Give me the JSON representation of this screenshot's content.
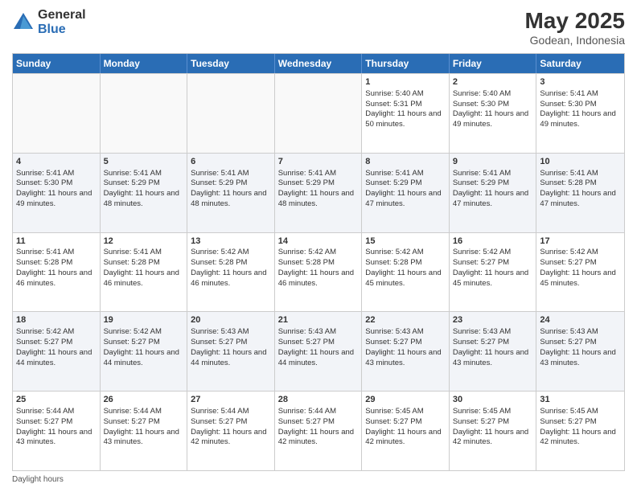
{
  "header": {
    "logo_general": "General",
    "logo_blue": "Blue",
    "main_title": "May 2025",
    "subtitle": "Godean, Indonesia"
  },
  "days_of_week": [
    "Sunday",
    "Monday",
    "Tuesday",
    "Wednesday",
    "Thursday",
    "Friday",
    "Saturday"
  ],
  "footer": {
    "daylight_label": "Daylight hours"
  },
  "weeks": [
    [
      {
        "day": "",
        "sunrise": "",
        "sunset": "",
        "daylight": "",
        "empty": true
      },
      {
        "day": "",
        "sunrise": "",
        "sunset": "",
        "daylight": "",
        "empty": true
      },
      {
        "day": "",
        "sunrise": "",
        "sunset": "",
        "daylight": "",
        "empty": true
      },
      {
        "day": "",
        "sunrise": "",
        "sunset": "",
        "daylight": "",
        "empty": true
      },
      {
        "day": "1",
        "sunrise": "Sunrise: 5:40 AM",
        "sunset": "Sunset: 5:31 PM",
        "daylight": "Daylight: 11 hours and 50 minutes.",
        "empty": false
      },
      {
        "day": "2",
        "sunrise": "Sunrise: 5:40 AM",
        "sunset": "Sunset: 5:30 PM",
        "daylight": "Daylight: 11 hours and 49 minutes.",
        "empty": false
      },
      {
        "day": "3",
        "sunrise": "Sunrise: 5:41 AM",
        "sunset": "Sunset: 5:30 PM",
        "daylight": "Daylight: 11 hours and 49 minutes.",
        "empty": false
      }
    ],
    [
      {
        "day": "4",
        "sunrise": "Sunrise: 5:41 AM",
        "sunset": "Sunset: 5:30 PM",
        "daylight": "Daylight: 11 hours and 49 minutes.",
        "empty": false
      },
      {
        "day": "5",
        "sunrise": "Sunrise: 5:41 AM",
        "sunset": "Sunset: 5:29 PM",
        "daylight": "Daylight: 11 hours and 48 minutes.",
        "empty": false
      },
      {
        "day": "6",
        "sunrise": "Sunrise: 5:41 AM",
        "sunset": "Sunset: 5:29 PM",
        "daylight": "Daylight: 11 hours and 48 minutes.",
        "empty": false
      },
      {
        "day": "7",
        "sunrise": "Sunrise: 5:41 AM",
        "sunset": "Sunset: 5:29 PM",
        "daylight": "Daylight: 11 hours and 48 minutes.",
        "empty": false
      },
      {
        "day": "8",
        "sunrise": "Sunrise: 5:41 AM",
        "sunset": "Sunset: 5:29 PM",
        "daylight": "Daylight: 11 hours and 47 minutes.",
        "empty": false
      },
      {
        "day": "9",
        "sunrise": "Sunrise: 5:41 AM",
        "sunset": "Sunset: 5:29 PM",
        "daylight": "Daylight: 11 hours and 47 minutes.",
        "empty": false
      },
      {
        "day": "10",
        "sunrise": "Sunrise: 5:41 AM",
        "sunset": "Sunset: 5:28 PM",
        "daylight": "Daylight: 11 hours and 47 minutes.",
        "empty": false
      }
    ],
    [
      {
        "day": "11",
        "sunrise": "Sunrise: 5:41 AM",
        "sunset": "Sunset: 5:28 PM",
        "daylight": "Daylight: 11 hours and 46 minutes.",
        "empty": false
      },
      {
        "day": "12",
        "sunrise": "Sunrise: 5:41 AM",
        "sunset": "Sunset: 5:28 PM",
        "daylight": "Daylight: 11 hours and 46 minutes.",
        "empty": false
      },
      {
        "day": "13",
        "sunrise": "Sunrise: 5:42 AM",
        "sunset": "Sunset: 5:28 PM",
        "daylight": "Daylight: 11 hours and 46 minutes.",
        "empty": false
      },
      {
        "day": "14",
        "sunrise": "Sunrise: 5:42 AM",
        "sunset": "Sunset: 5:28 PM",
        "daylight": "Daylight: 11 hours and 46 minutes.",
        "empty": false
      },
      {
        "day": "15",
        "sunrise": "Sunrise: 5:42 AM",
        "sunset": "Sunset: 5:28 PM",
        "daylight": "Daylight: 11 hours and 45 minutes.",
        "empty": false
      },
      {
        "day": "16",
        "sunrise": "Sunrise: 5:42 AM",
        "sunset": "Sunset: 5:27 PM",
        "daylight": "Daylight: 11 hours and 45 minutes.",
        "empty": false
      },
      {
        "day": "17",
        "sunrise": "Sunrise: 5:42 AM",
        "sunset": "Sunset: 5:27 PM",
        "daylight": "Daylight: 11 hours and 45 minutes.",
        "empty": false
      }
    ],
    [
      {
        "day": "18",
        "sunrise": "Sunrise: 5:42 AM",
        "sunset": "Sunset: 5:27 PM",
        "daylight": "Daylight: 11 hours and 44 minutes.",
        "empty": false
      },
      {
        "day": "19",
        "sunrise": "Sunrise: 5:42 AM",
        "sunset": "Sunset: 5:27 PM",
        "daylight": "Daylight: 11 hours and 44 minutes.",
        "empty": false
      },
      {
        "day": "20",
        "sunrise": "Sunrise: 5:43 AM",
        "sunset": "Sunset: 5:27 PM",
        "daylight": "Daylight: 11 hours and 44 minutes.",
        "empty": false
      },
      {
        "day": "21",
        "sunrise": "Sunrise: 5:43 AM",
        "sunset": "Sunset: 5:27 PM",
        "daylight": "Daylight: 11 hours and 44 minutes.",
        "empty": false
      },
      {
        "day": "22",
        "sunrise": "Sunrise: 5:43 AM",
        "sunset": "Sunset: 5:27 PM",
        "daylight": "Daylight: 11 hours and 43 minutes.",
        "empty": false
      },
      {
        "day": "23",
        "sunrise": "Sunrise: 5:43 AM",
        "sunset": "Sunset: 5:27 PM",
        "daylight": "Daylight: 11 hours and 43 minutes.",
        "empty": false
      },
      {
        "day": "24",
        "sunrise": "Sunrise: 5:43 AM",
        "sunset": "Sunset: 5:27 PM",
        "daylight": "Daylight: 11 hours and 43 minutes.",
        "empty": false
      }
    ],
    [
      {
        "day": "25",
        "sunrise": "Sunrise: 5:44 AM",
        "sunset": "Sunset: 5:27 PM",
        "daylight": "Daylight: 11 hours and 43 minutes.",
        "empty": false
      },
      {
        "day": "26",
        "sunrise": "Sunrise: 5:44 AM",
        "sunset": "Sunset: 5:27 PM",
        "daylight": "Daylight: 11 hours and 43 minutes.",
        "empty": false
      },
      {
        "day": "27",
        "sunrise": "Sunrise: 5:44 AM",
        "sunset": "Sunset: 5:27 PM",
        "daylight": "Daylight: 11 hours and 42 minutes.",
        "empty": false
      },
      {
        "day": "28",
        "sunrise": "Sunrise: 5:44 AM",
        "sunset": "Sunset: 5:27 PM",
        "daylight": "Daylight: 11 hours and 42 minutes.",
        "empty": false
      },
      {
        "day": "29",
        "sunrise": "Sunrise: 5:45 AM",
        "sunset": "Sunset: 5:27 PM",
        "daylight": "Daylight: 11 hours and 42 minutes.",
        "empty": false
      },
      {
        "day": "30",
        "sunrise": "Sunrise: 5:45 AM",
        "sunset": "Sunset: 5:27 PM",
        "daylight": "Daylight: 11 hours and 42 minutes.",
        "empty": false
      },
      {
        "day": "31",
        "sunrise": "Sunrise: 5:45 AM",
        "sunset": "Sunset: 5:27 PM",
        "daylight": "Daylight: 11 hours and 42 minutes.",
        "empty": false
      }
    ]
  ]
}
